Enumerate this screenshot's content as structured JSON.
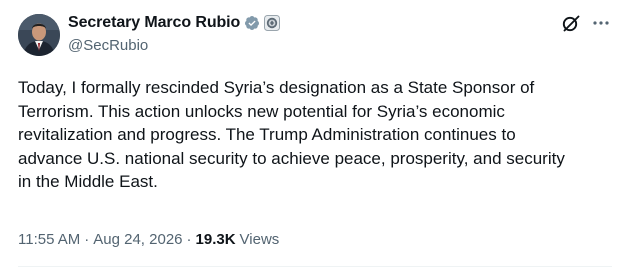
{
  "tweet": {
    "author": {
      "display_name": "Secretary Marco Rubio",
      "handle": "@SecRubio",
      "verified": true,
      "icons": [
        "verified-badge-icon",
        "affiliate-seal-icon"
      ]
    },
    "actions": {
      "grok_icon": "grok-icon",
      "more_icon": "more-options-icon"
    },
    "text": "Today, I formally rescinded Syria’s designation as a State Sponsor of\nTerrorism. This action unlocks new potential for Syria’s economic\nrevitalization and progress. The Trump Administration continues to\nadvance U.S. national security to achieve peace, prosperity, and security\nin the Middle East.",
    "time": "11:55 AM",
    "separator": "·",
    "date": "Aug 24, 2026",
    "views_count": "19.3K",
    "views_label": "Views"
  },
  "colors": {
    "text_primary": "#0f1419",
    "text_secondary": "#536471",
    "verified_badge": "#829aab",
    "divider": "#eff3f4"
  }
}
